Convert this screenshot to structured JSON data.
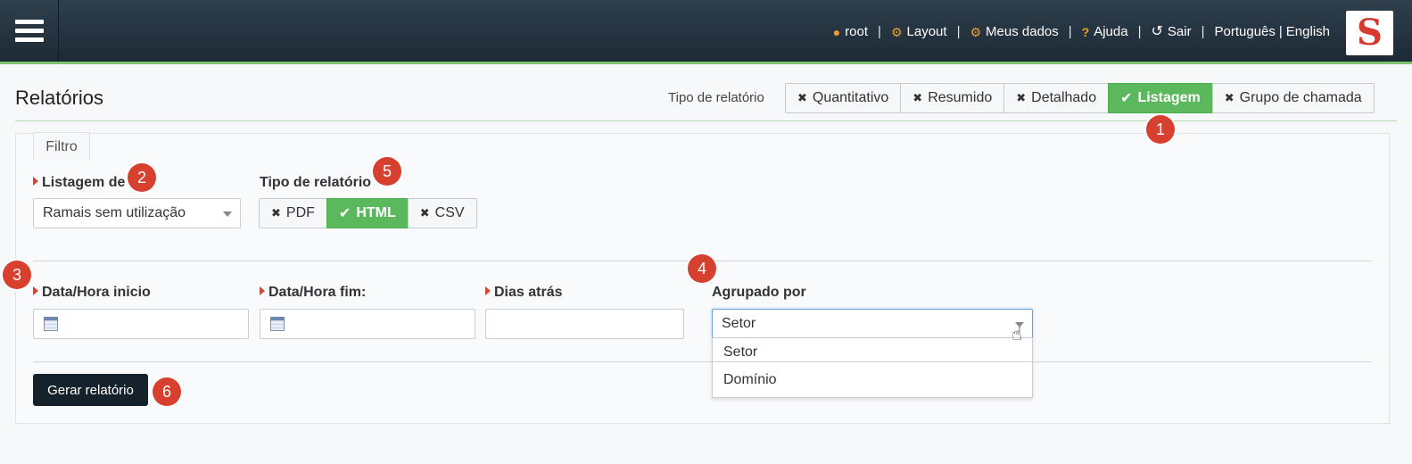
{
  "nav": {
    "user": "root",
    "layout": "Layout",
    "meus_dados": "Meus dados",
    "ajuda": "Ajuda",
    "sair": "Sair",
    "lang_pt": "Português",
    "lang_sep": "|",
    "lang_en": "English",
    "separator": "|"
  },
  "page": {
    "title": "Relatórios",
    "tipo_label": "Tipo de relatório"
  },
  "report_types": [
    "Quantitativo",
    "Resumido",
    "Detalhado",
    "Listagem",
    "Grupo de chamada"
  ],
  "report_types_selected": "Listagem",
  "filter": {
    "tab": "Filtro",
    "listagem_label": "Listagem de",
    "listagem_value": "Ramais sem utilização",
    "tipo_label": "Tipo de relatório",
    "format_pdf": "PDF",
    "format_html": "HTML",
    "format_csv": "CSV",
    "format_selected": "HTML",
    "inicio_label": "Data/Hora inicio",
    "fim_label": "Data/Hora fim:",
    "dias_label": "Dias atrás",
    "agrupado_label": "Agrupado por",
    "agrupado_value": "Setor",
    "agrupado_options": [
      "Setor",
      "Domínio"
    ],
    "submit": "Gerar relatório"
  },
  "badges": [
    "1",
    "2",
    "3",
    "4",
    "5",
    "6"
  ],
  "colors": {
    "accent_green": "#5cb85c",
    "badge_red": "#d7402e",
    "topbar": "#1c2a35",
    "icon_orange": "#f0a02c"
  },
  "icons": [
    "menu-icon",
    "user-icon",
    "cogs-icon",
    "gear-icon",
    "question-icon",
    "sign-out-icon",
    "times-icon",
    "check-icon",
    "calendar-icon",
    "caret-down-icon",
    "pointer-cursor-icon"
  ]
}
